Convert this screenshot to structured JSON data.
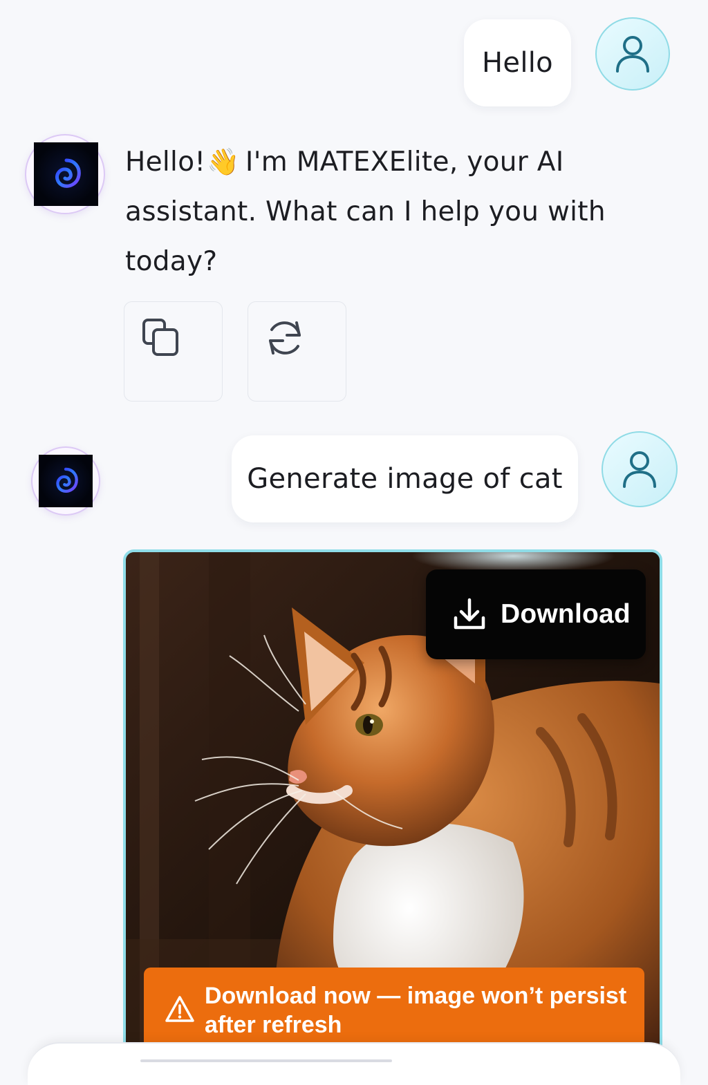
{
  "messages": {
    "user_1": "Hello",
    "assistant_1": {
      "greeting": "Hello!",
      "emoji": "👋",
      "rest": "I'm MATEXElite, your AI assistant. What can I help you with today?"
    },
    "user_2": "Generate image of cat"
  },
  "actions": {
    "copy_icon": "copy-icon",
    "regenerate_icon": "refresh-icon"
  },
  "image_card": {
    "download_label": "Download",
    "warning": "Download now — image won’t persist after refresh"
  },
  "colors": {
    "page_bg": "#f7f8fb",
    "user_avatar_border": "#8fdbe6",
    "image_border": "#8fdde8",
    "warning_bg": "#ec6d0e",
    "download_bg": "#050505"
  }
}
